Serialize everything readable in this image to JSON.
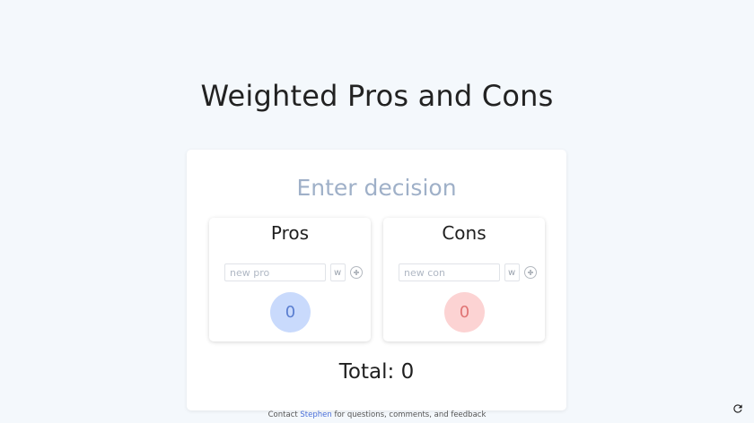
{
  "page": {
    "title": "Weighted Pros and Cons"
  },
  "decision": {
    "placeholder": "Enter decision",
    "value": ""
  },
  "pros": {
    "title": "Pros",
    "item_placeholder": "new pro",
    "weight_placeholder": "w",
    "add_icon": "plus-circle-icon",
    "score": "0",
    "score_bg": "#c9dafc",
    "score_color": "#5a7ed0"
  },
  "cons": {
    "title": "Cons",
    "item_placeholder": "new con",
    "weight_placeholder": "w",
    "add_icon": "plus-circle-icon",
    "score": "0",
    "score_bg": "#fcd3d3",
    "score_color": "#e07474"
  },
  "total": {
    "label": "Total:",
    "value": "0"
  },
  "footer": {
    "prefix": "Contact",
    "link": "Stephen",
    "suffix": "for questions, comments, and feedback"
  },
  "controls": {
    "refresh_icon": "refresh-icon"
  },
  "colors": {
    "background": "#f4f8fc",
    "link": "#4a6fd8"
  }
}
